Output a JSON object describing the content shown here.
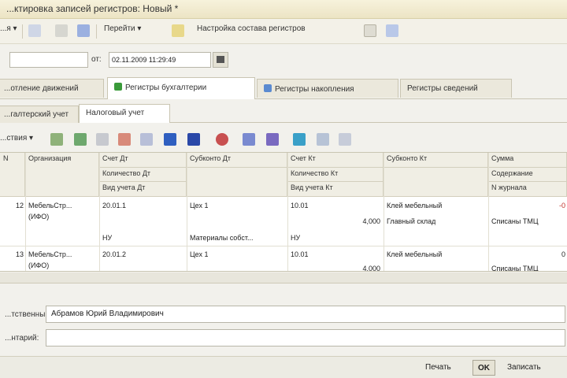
{
  "window": {
    "title": "...ктировка записей регистров: Новый *"
  },
  "toolbar": {
    "actions_label": "...я",
    "goto_label": "Перейти",
    "settings_label": "Настройка состава регистров"
  },
  "header": {
    "from_label": "от:",
    "date_value": "02.11.2009 11:29:49"
  },
  "tabs": [
    {
      "label": "...отление движений",
      "active": false
    },
    {
      "label": "Регистры бухгалтерии",
      "active": true
    },
    {
      "label": "Регистры накопления",
      "active": false
    },
    {
      "label": "Регистры сведений",
      "active": false
    }
  ],
  "subtabs": [
    {
      "label": "...галтерский учет",
      "active": false
    },
    {
      "label": "Налоговый учет",
      "active": true
    }
  ],
  "toolbar2": {
    "actions_label": "...ствия"
  },
  "grid": {
    "headers": {
      "n": "N",
      "org": "Организация",
      "dt_account": "Счет Дт",
      "dt_qty": "Количество Дт",
      "dt_type": "Вид учета Дт",
      "dt_sub": "Субконто Дт",
      "kt_account": "Счет Кт",
      "kt_qty": "Количество Кт",
      "kt_type": "Вид учета Кт",
      "kt_sub": "Субконто Кт",
      "sum": "Сумма",
      "content": "Содержание",
      "journal": "N журнала"
    },
    "rows": [
      {
        "n": "12",
        "org": "МебельСтр...",
        "org2": "(ИФО)",
        "dt_account": "20.01.1",
        "dt_type": "НУ",
        "dt_sub1": "Цех 1",
        "dt_sub2": "Материалы собст...",
        "kt_account": "10.01",
        "kt_qty": "4,000",
        "kt_type": "НУ",
        "kt_sub1": "Клей мебельный",
        "kt_sub2": "Главный склад",
        "sum": "-0",
        "content": "Списаны ТМЦ"
      },
      {
        "n": "13",
        "org": "МебельСтр...",
        "org2": "(ИФО)",
        "dt_account": "20.01.2",
        "dt_sub1": "Цех 1",
        "kt_account": "10.01",
        "kt_qty": "4,000",
        "kt_sub1": "Клей мебельный",
        "sum": "0",
        "content": "Списаны ТМЦ"
      }
    ]
  },
  "footer": {
    "responsible_label": "...тственный:",
    "responsible_value": "Абрамов Юрий Владимирович",
    "comment_label": "...нтарий:",
    "comment_value": ""
  },
  "buttons": {
    "print": "Печать",
    "ok": "OK",
    "save": "Записать"
  },
  "colors": {
    "accent_green": "#3a9a3a",
    "accent_blue": "#2f5fc0",
    "accent_red": "#cc3a2a"
  }
}
